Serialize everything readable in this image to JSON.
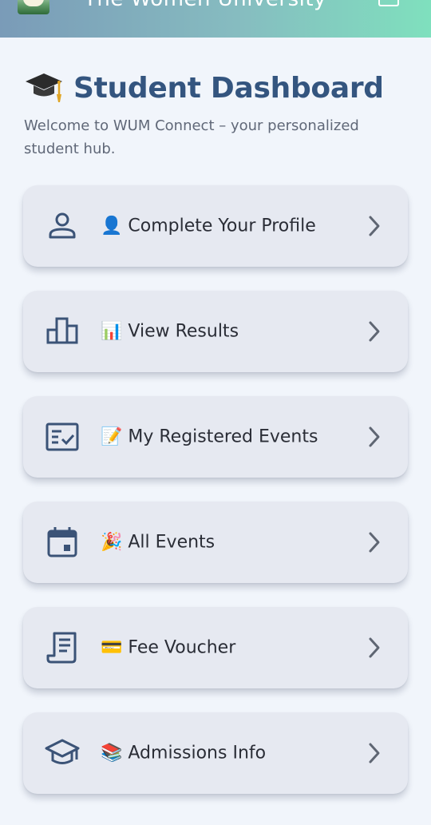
{
  "app_bar": {
    "title": "The Women University",
    "logo_icon": "university-crest-icon",
    "action_icon": "logout-icon",
    "gradient": [
      "#7a9bb8",
      "#86bcc0",
      "#7fe0be"
    ]
  },
  "header": {
    "icon": "graduation-cap-icon",
    "title": "Student Dashboard",
    "subtitle": "Welcome to WUM Connect – your personalized student hub."
  },
  "menu": {
    "items": [
      {
        "icon": "person-icon",
        "label": "👤 Complete Your Profile"
      },
      {
        "icon": "bar-chart-icon",
        "label": "📊 View Results"
      },
      {
        "icon": "checklist-icon",
        "label": "📝 My Registered Events"
      },
      {
        "icon": "calendar-icon",
        "label": "🎉 All Events"
      },
      {
        "icon": "receipt-icon",
        "label": "💳 Fee Voucher"
      },
      {
        "icon": "school-icon",
        "label": "📚 Admissions Info"
      }
    ],
    "chevron_icon": "chevron-right-icon"
  },
  "colors": {
    "accent": "#34557f",
    "card": "#e6e9f1",
    "background": "#f1f5fb"
  }
}
